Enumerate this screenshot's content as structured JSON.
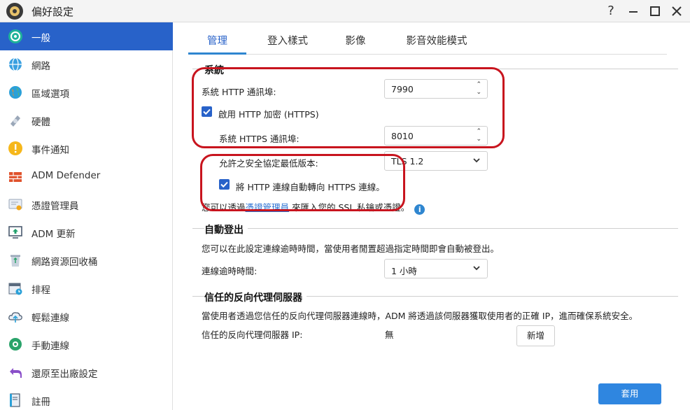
{
  "window": {
    "title": "偏好設定",
    "help": "?",
    "minimize": "—",
    "maximize": "☐",
    "close": "✕"
  },
  "sidebar": {
    "items": [
      {
        "label": "一般",
        "icon": "general-icon"
      },
      {
        "label": "網路",
        "icon": "network-globe-icon"
      },
      {
        "label": "區域選項",
        "icon": "region-globe-icon"
      },
      {
        "label": "硬體",
        "icon": "hardware-icon"
      },
      {
        "label": "事件通知",
        "icon": "alert-icon"
      },
      {
        "label": "ADM Defender",
        "icon": "firewall-icon"
      },
      {
        "label": "憑證管理員",
        "icon": "certificate-icon"
      },
      {
        "label": "ADM 更新",
        "icon": "update-icon"
      },
      {
        "label": "網路資源回收桶",
        "icon": "recycle-icon"
      },
      {
        "label": "排程",
        "icon": "schedule-icon"
      },
      {
        "label": "輕鬆連線",
        "icon": "cloud-connect-icon"
      },
      {
        "label": "手動連線",
        "icon": "manual-connect-icon"
      },
      {
        "label": "還原至出廠設定",
        "icon": "restore-icon"
      },
      {
        "label": "註冊",
        "icon": "register-icon"
      }
    ]
  },
  "tabs": [
    {
      "label": "管理"
    },
    {
      "label": "登入樣式"
    },
    {
      "label": "影像"
    },
    {
      "label": "影音效能模式"
    }
  ],
  "system": {
    "title": "系統",
    "http_port_label": "系統 HTTP 通訊埠:",
    "http_port_value": "7990",
    "https_enable_label": "啟用 HTTP 加密 (HTTPS)",
    "https_port_label": "系統 HTTPS 通訊埠:",
    "https_port_value": "8010",
    "tls_label": "允許之安全協定最低版本:",
    "tls_value": "TLS 1.2",
    "redirect_label": "將 HTTP 連線自動轉向 HTTPS 連線。",
    "ssl_prefix": "您可以透過",
    "ssl_link": "憑證管理員",
    "ssl_suffix": "來匯入您的 SSL 私鑰或憑證。",
    "info": "i"
  },
  "auto_logout": {
    "title": "自動登出",
    "desc": "您可以在此設定連線逾時時間，當使用者閒置超過指定時間即會自動被登出。",
    "timeout_label": "連線逾時時間:",
    "timeout_value": "1 小時"
  },
  "proxy": {
    "title": "信任的反向代理伺服器",
    "desc": "當使用者透過您信任的反向代理伺服器連線時，ADM 將透過該伺服器獲取使用者的正確 IP，進而確保系統安全。",
    "ip_label": "信任的反向代理伺服器 IP:",
    "ip_value": "無",
    "add_button": "新增"
  },
  "apply_button": "套用",
  "colors": {
    "accent": "#2862c9",
    "annotation": "#c8141e",
    "primary_button": "#2f86e0"
  }
}
